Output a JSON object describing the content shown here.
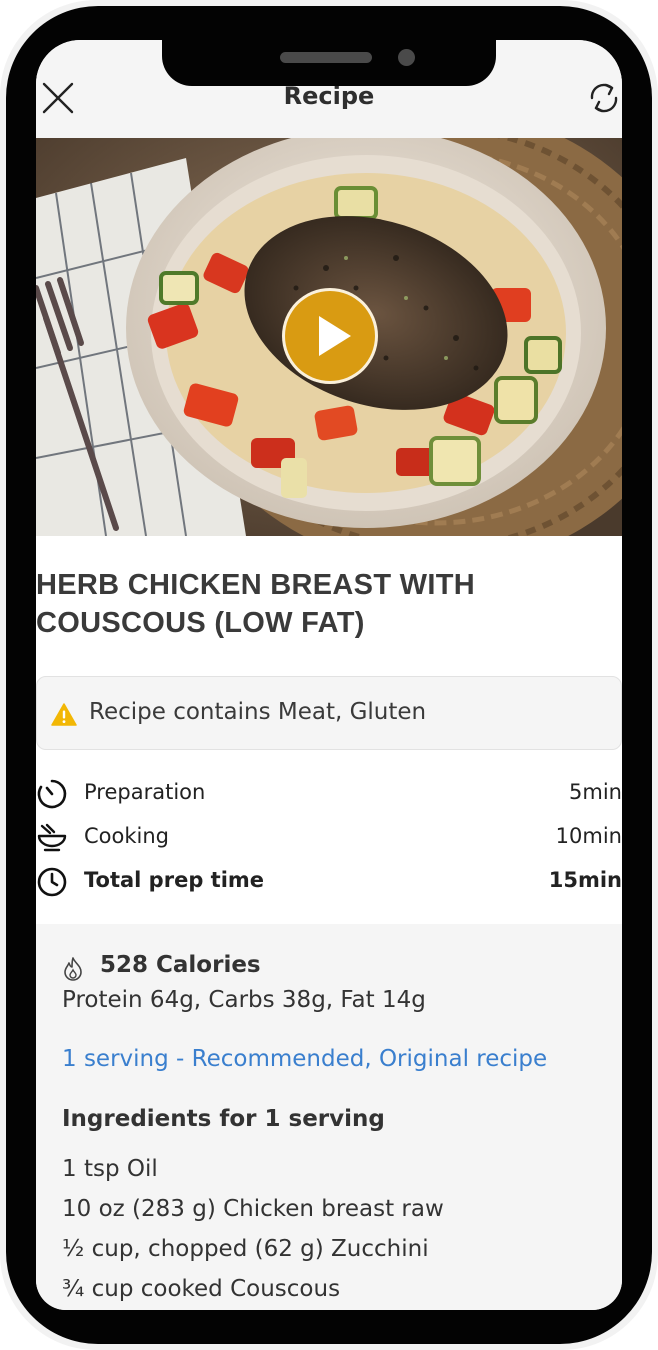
{
  "header": {
    "title": "Recipe",
    "close_icon": "close-icon",
    "sync_icon": "sync-icon"
  },
  "hero": {
    "play_icon": "play-icon",
    "accent_color": "#d99b12"
  },
  "recipe": {
    "title": "HERB CHICKEN BREAST WITH COUSCOUS (LOW FAT)"
  },
  "allergen": {
    "icon": "warning-icon",
    "text": "Recipe contains Meat, Gluten",
    "color": "#f2b705"
  },
  "times": [
    {
      "icon": "timer-icon",
      "label": "Preparation",
      "value": "5min"
    },
    {
      "icon": "cooking-pot-icon",
      "label": "Cooking",
      "value": "10min"
    },
    {
      "icon": "clock-icon",
      "label": "Total prep time",
      "value": "15min"
    }
  ],
  "nutrition": {
    "icon": "flame-icon",
    "calories": "528 Calories",
    "macros": "Protein 64g, Carbs 38g, Fat 14g",
    "serving_link": "1 serving - Recommended, Original recipe",
    "link_color": "#3a7fce",
    "ingredients_heading": "Ingredients for 1 serving",
    "ingredients": [
      "1 tsp Oil",
      "10 oz (283 g) Chicken breast raw",
      "½ cup, chopped (62 g) Zucchini",
      "¾ cup cooked Couscous"
    ]
  }
}
